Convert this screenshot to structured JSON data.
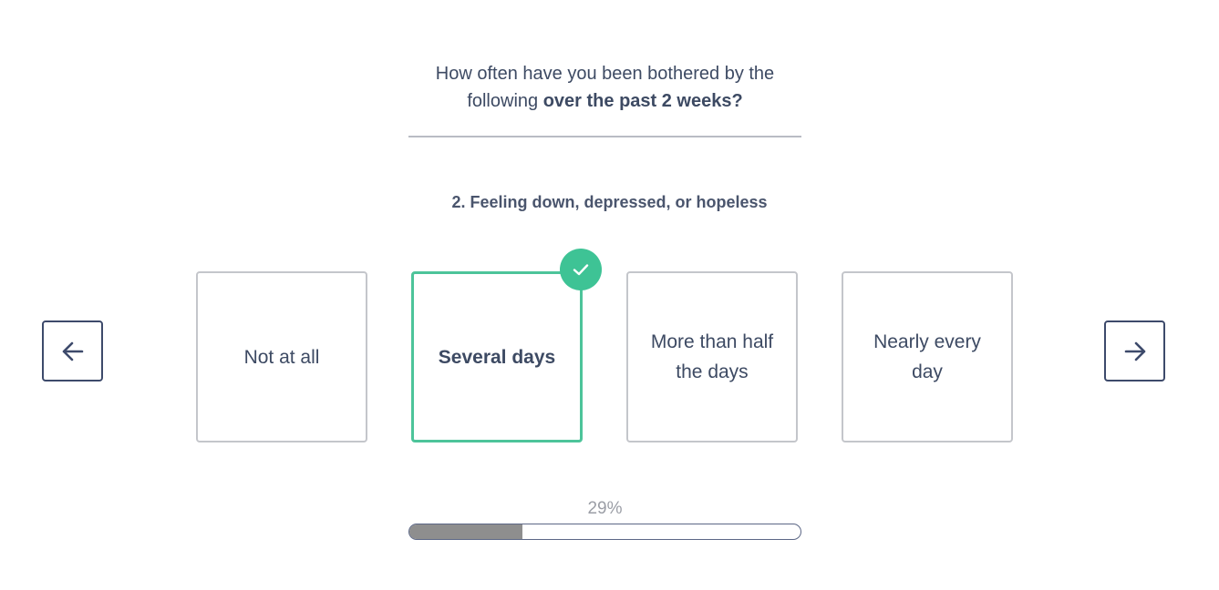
{
  "intro": {
    "text": "How often have you been bothered by the following ",
    "emphasis": "over the past 2 weeks?"
  },
  "question": {
    "text": "2. Feeling down, depressed, or hopeless"
  },
  "nav": {
    "prev_icon": "arrow-left-icon",
    "next_icon": "arrow-right-icon"
  },
  "options": [
    {
      "label": "Not at all",
      "selected": false
    },
    {
      "label": "Several days",
      "selected": true
    },
    {
      "label": "More than half the days",
      "selected": false
    },
    {
      "label": "Nearly every day",
      "selected": false
    }
  ],
  "selected_icon": "checkmark-icon",
  "progress": {
    "label": "29%",
    "value": 0.29
  },
  "colors": {
    "text": "#3d4a63",
    "accent": "#3ec395",
    "selected_border": "#4dc49a",
    "progress_fill": "#8e8e8e",
    "nav_border": "#3d4a6b"
  }
}
